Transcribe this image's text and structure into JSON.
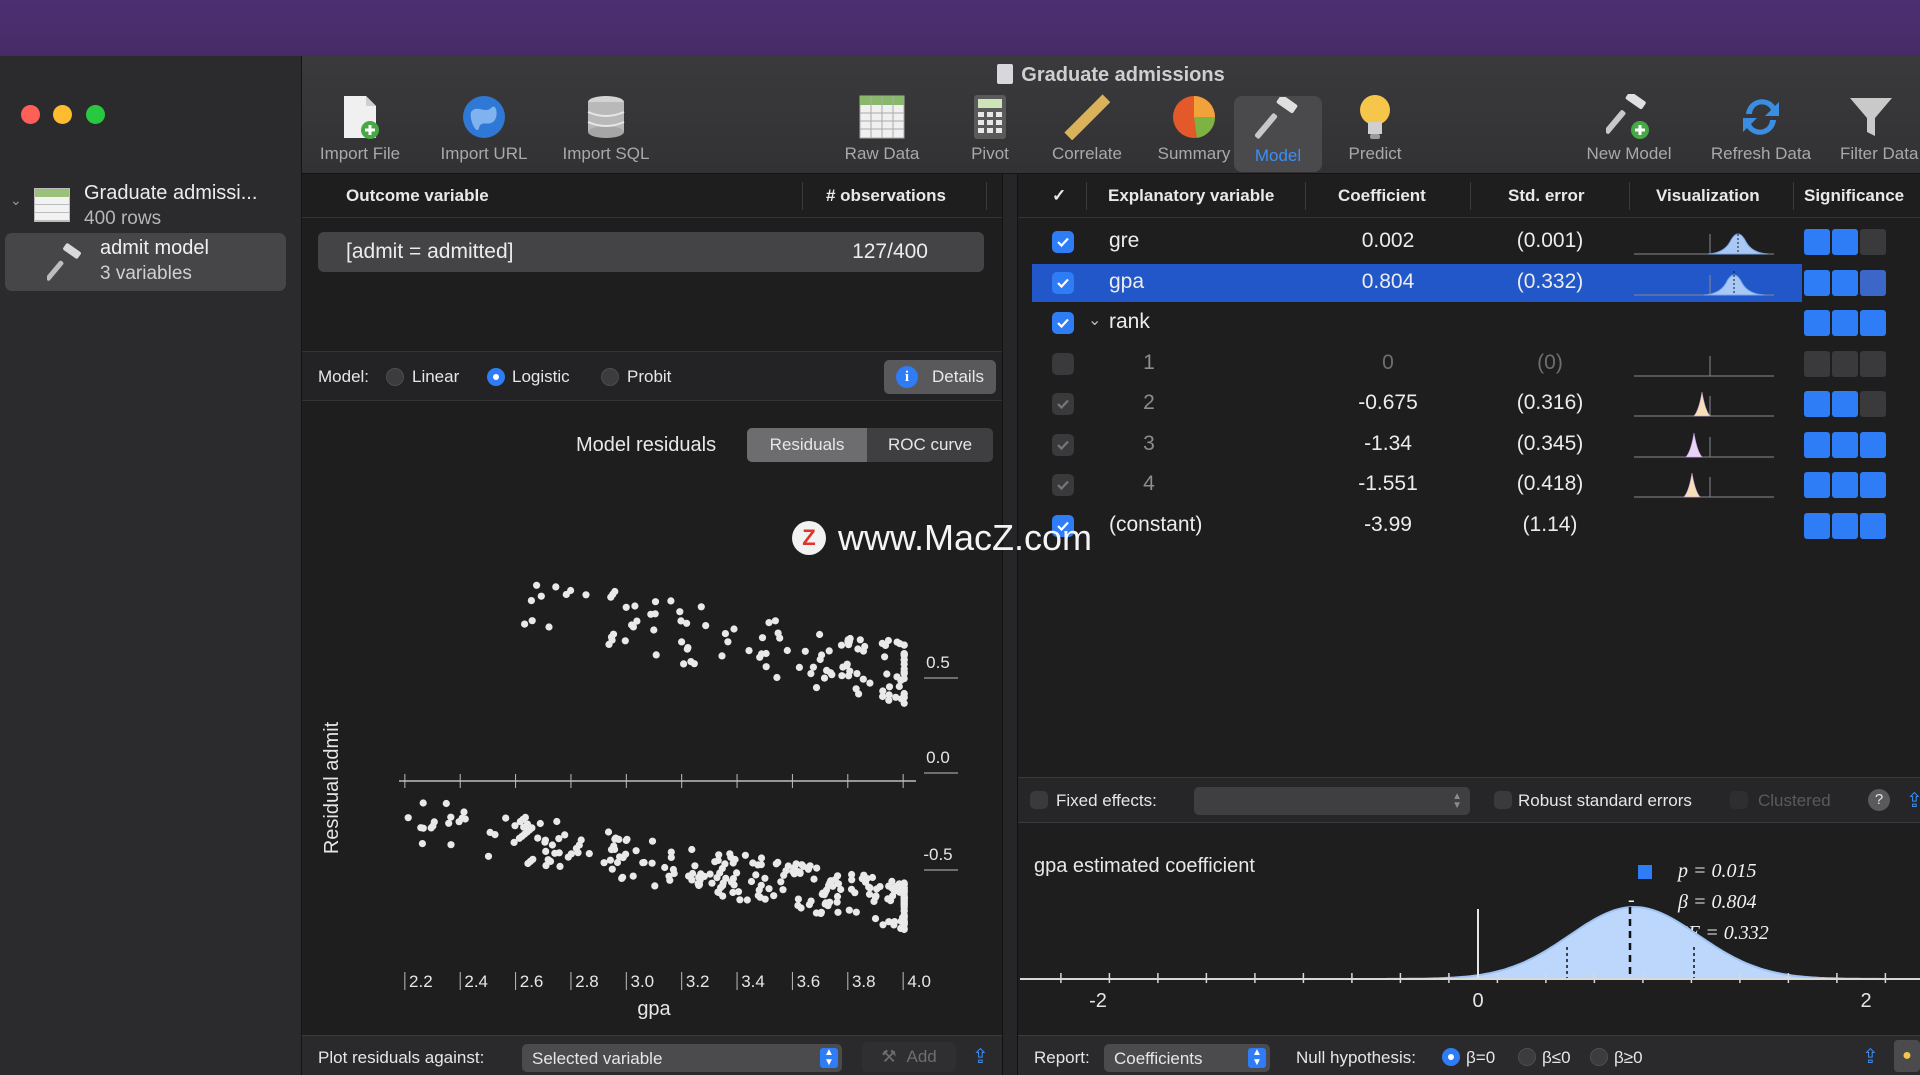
{
  "window": {
    "title": "Graduate admissions"
  },
  "sidebar": {
    "dataset": {
      "name": "Graduate admissi...",
      "rows": "400 rows"
    },
    "model": {
      "name": "admit model",
      "vars": "3 variables"
    }
  },
  "toolbar": {
    "import_file": "Import File",
    "import_url": "Import URL",
    "import_sql": "Import SQL",
    "raw_data": "Raw Data",
    "pivot": "Pivot",
    "correlate": "Correlate",
    "summary": "Summary",
    "model": "Model",
    "predict": "Predict",
    "new_model": "New Model",
    "refresh_data": "Refresh Data",
    "filter_data": "Filter Data"
  },
  "outcome": {
    "col_outcome": "Outcome variable",
    "col_obs": "# observations",
    "value": "[admit = admitted]",
    "obs": "127/400"
  },
  "modelrow": {
    "label": "Model:",
    "linear": "Linear",
    "logistic": "Logistic",
    "probit": "Probit",
    "details": "Details"
  },
  "residuals": {
    "title": "Model residuals",
    "tab_residuals": "Residuals",
    "tab_roc": "ROC curve"
  },
  "scatter": {
    "xlabel": "gpa",
    "ylabel": "Residual admit",
    "xticks": [
      "2.2",
      "2.4",
      "2.6",
      "2.8",
      "3.0",
      "3.2",
      "3.4",
      "3.6",
      "3.8",
      "4.0"
    ],
    "yticks": [
      "0.5",
      "0.0",
      "-0.5"
    ]
  },
  "plotbar": {
    "label": "Plot residuals against:",
    "select": "Selected variable",
    "add": "Add"
  },
  "table": {
    "headers": {
      "check": "✓",
      "var": "Explanatory variable",
      "coef": "Coefficient",
      "se": "Std. error",
      "viz": "Visualization",
      "sig": "Significance"
    },
    "rows": [
      {
        "name": "gre",
        "coef": "0.002",
        "se": "(0.001)"
      },
      {
        "name": "gpa",
        "coef": "0.804",
        "se": "(0.332)"
      },
      {
        "name": "rank",
        "coef": "",
        "se": ""
      },
      {
        "name": "1",
        "coef": "0",
        "se": "(0)"
      },
      {
        "name": "2",
        "coef": "-0.675",
        "se": "(0.316)"
      },
      {
        "name": "3",
        "coef": "-1.34",
        "se": "(0.345)"
      },
      {
        "name": "4",
        "coef": "-1.551",
        "se": "(0.418)"
      },
      {
        "name": "(constant)",
        "coef": "-3.99",
        "se": "(1.14)"
      }
    ]
  },
  "options": {
    "fixed_effects": "Fixed effects:",
    "robust": "Robust standard errors",
    "clustered": "Clustered",
    "help": "?"
  },
  "coefplot": {
    "title": "gpa estimated coefficient",
    "p": "p = 0.015",
    "beta": "β = 0.804",
    "se": "SE = 0.332",
    "xticks": [
      "-2",
      "0",
      "2"
    ]
  },
  "bottombar": {
    "report": "Report:",
    "report_value": "Coefficients",
    "null": "Null hypothesis:",
    "h1": "β=0",
    "h2": "β≤0",
    "h3": "β≥0"
  },
  "watermark": "www.MacZ.com",
  "colors": {
    "accent": "#2f7df6",
    "selected_row": "#2257c9"
  },
  "chart_data": {
    "type": "scatter",
    "title": "Model residuals",
    "xlabel": "gpa",
    "ylabel": "Residual admit",
    "xlim": [
      2.2,
      4.0
    ],
    "ylim": [
      -0.8,
      0.8
    ],
    "grid": false
  }
}
